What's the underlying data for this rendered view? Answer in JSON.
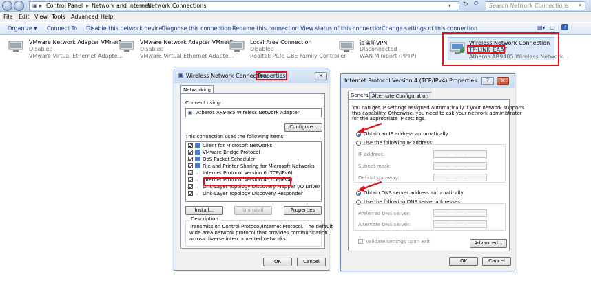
{
  "address_bar": {
    "breadcrumb": [
      "Control Panel",
      "Network and Internet",
      "Network Connections"
    ],
    "search_placeholder": "Search Network Connections"
  },
  "menu": [
    "File",
    "Edit",
    "View",
    "Tools",
    "Advanced",
    "Help"
  ],
  "toolbar": {
    "organize": "Organize ▾",
    "items": [
      "Connect To",
      "Disable this network device",
      "Diagnose this connection",
      "Rename this connection",
      "View status of this connection",
      "Change settings of this connection"
    ]
  },
  "adapters": [
    {
      "name": "VMware Network Adapter VMnet1",
      "status": "Disabled",
      "device": "VMware Virtual Ethernet Adapte..."
    },
    {
      "name": "VMware Network Adapter VMnet8",
      "status": "Disabled",
      "device": "VMware Virtual Ethernet Adapte..."
    },
    {
      "name": "Local Area Connection",
      "status": "Disabled",
      "device": "Realtek PCIe GBE Family Controller"
    },
    {
      "name": "海盗船VPN",
      "status": "Disconnected",
      "device": "WAN Miniport (PPTP)"
    },
    {
      "name": "Wireless Network Connection",
      "status": "TP-LINK_EAAF",
      "device": "Atheros AR9485 Wireless Network..."
    }
  ],
  "properties_dialog": {
    "title_prefix": "Wireless Network Connection",
    "title_suffix": "Properties",
    "tab": "Networking",
    "connect_using_label": "Connect using:",
    "adapter_name": "Atheros AR9485 Wireless Network Adapter",
    "configure_btn": "Configure...",
    "items_label": "This connection uses the following items:",
    "items": [
      {
        "label": "Client for Microsoft Networks",
        "checked": true
      },
      {
        "label": "VMware Bridge Protocol",
        "checked": true
      },
      {
        "label": "QoS Packet Scheduler",
        "checked": true
      },
      {
        "label": "File and Printer Sharing for Microsoft Networks",
        "checked": true
      },
      {
        "label": "Internet Protocol Version 6 (TCP/IPv6)",
        "checked": true
      },
      {
        "label": "Internet Protocol Version 4 (TCP/IPv4)",
        "checked": true
      },
      {
        "label": "Link-Layer Topology Discovery Mapper I/O Driver",
        "checked": true
      },
      {
        "label": "Link-Layer Topology Discovery Responder",
        "checked": true
      }
    ],
    "install_btn": "Install...",
    "uninstall_btn": "Uninstall",
    "properties_btn": "Properties",
    "description_label": "Description",
    "description_text_1": "Transmission Control Protocol/Internet Protocol. The default",
    "description_text_2": "wide area network protocol that provides communication",
    "description_text_3": "across diverse interconnected networks.",
    "ok_btn": "OK",
    "cancel_btn": "Cancel"
  },
  "ipv4_dialog": {
    "title": "Internet Protocol Version 4 (TCP/IPv4) Properties",
    "help_btn": "?",
    "close_btn": "✕",
    "tab_general": "General",
    "tab_alternate": "Alternate Configuration",
    "intro_1": "You can get IP settings assigned automatically if your network supports",
    "intro_2": "this capability. Otherwise, you need to ask your network administrator",
    "intro_3": "for the appropriate IP settings.",
    "auto_ip": "Obtain an IP address automatically",
    "manual_ip": "Use the following IP address:",
    "ip_address": "IP address:",
    "subnet_mask": "Subnet mask:",
    "default_gateway": "Default gateway:",
    "auto_dns": "Obtain DNS server address automatically",
    "manual_dns": "Use the following DNS server addresses:",
    "preferred_dns": "Preferred DNS server:",
    "alternate_dns": "Alternate DNS server:",
    "validate": "Validate settings upon exit",
    "advanced_btn": "Advanced...",
    "ok_btn": "OK",
    "cancel_btn": "Cancel",
    "ip_placeholder": "...",
    "selected_ip_mode": "auto",
    "selected_dns_mode": "auto"
  },
  "colors": {
    "highlight": "#e0141e",
    "link": "#1e3287"
  }
}
